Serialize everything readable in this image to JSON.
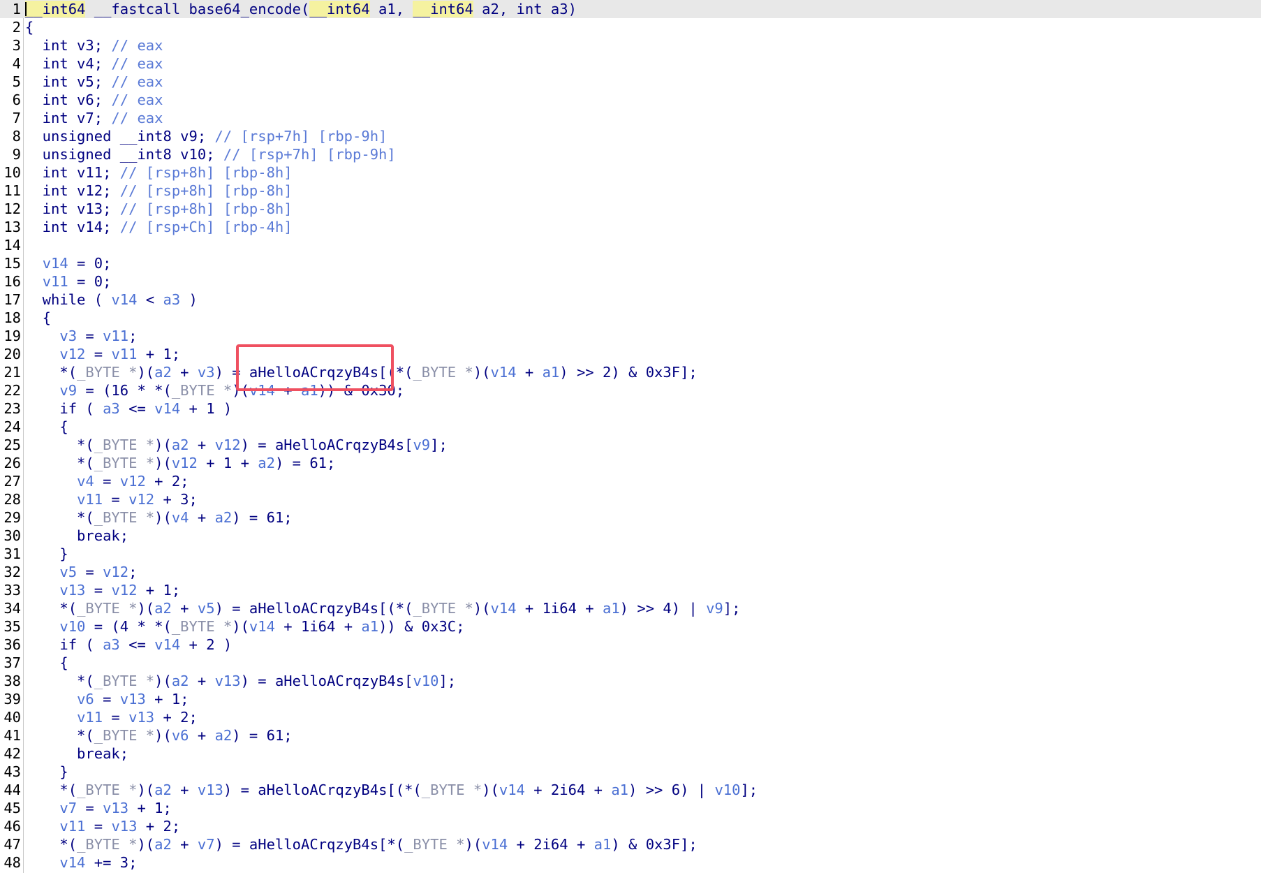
{
  "editor": {
    "type": "pseudocode-view",
    "current_line": 1,
    "lines": [
      {
        "n": "1",
        "tokens": [
          [
            "hl",
            "__int64"
          ],
          [
            "p",
            " __fastcall base64_encode("
          ],
          [
            "hl",
            "__int64"
          ],
          [
            "p",
            " a1, "
          ],
          [
            "hl",
            "__int64"
          ],
          [
            "p",
            " a2, int a3)"
          ]
        ]
      },
      {
        "n": "2",
        "tokens": [
          [
            "p",
            "{"
          ]
        ]
      },
      {
        "n": "3",
        "tokens": [
          [
            "p",
            "  int v3; "
          ],
          [
            "c",
            "// eax"
          ]
        ]
      },
      {
        "n": "4",
        "tokens": [
          [
            "p",
            "  int v4; "
          ],
          [
            "c",
            "// eax"
          ]
        ]
      },
      {
        "n": "5",
        "tokens": [
          [
            "p",
            "  int v5; "
          ],
          [
            "c",
            "// eax"
          ]
        ]
      },
      {
        "n": "6",
        "tokens": [
          [
            "p",
            "  int v6; "
          ],
          [
            "c",
            "// eax"
          ]
        ]
      },
      {
        "n": "7",
        "tokens": [
          [
            "p",
            "  int v7; "
          ],
          [
            "c",
            "// eax"
          ]
        ]
      },
      {
        "n": "8",
        "tokens": [
          [
            "p",
            "  unsigned __int8 v9; "
          ],
          [
            "c",
            "// [rsp+7h] [rbp-9h]"
          ]
        ]
      },
      {
        "n": "9",
        "tokens": [
          [
            "p",
            "  unsigned __int8 v10; "
          ],
          [
            "c",
            "// [rsp+7h] [rbp-9h]"
          ]
        ]
      },
      {
        "n": "10",
        "tokens": [
          [
            "p",
            "  int v11; "
          ],
          [
            "c",
            "// [rsp+8h] [rbp-8h]"
          ]
        ]
      },
      {
        "n": "11",
        "tokens": [
          [
            "p",
            "  int v12; "
          ],
          [
            "c",
            "// [rsp+8h] [rbp-8h]"
          ]
        ]
      },
      {
        "n": "12",
        "tokens": [
          [
            "p",
            "  int v13; "
          ],
          [
            "c",
            "// [rsp+8h] [rbp-8h]"
          ]
        ]
      },
      {
        "n": "13",
        "tokens": [
          [
            "p",
            "  int v14; "
          ],
          [
            "c",
            "// [rsp+Ch] [rbp-4h]"
          ]
        ]
      },
      {
        "n": "14",
        "tokens": [
          [
            "p",
            ""
          ]
        ]
      },
      {
        "n": "15",
        "tokens": [
          [
            "p",
            "  "
          ],
          [
            "v",
            "v14"
          ],
          [
            "p",
            " = 0;"
          ]
        ]
      },
      {
        "n": "16",
        "tokens": [
          [
            "p",
            "  "
          ],
          [
            "v",
            "v11"
          ],
          [
            "p",
            " = 0;"
          ]
        ]
      },
      {
        "n": "17",
        "tokens": [
          [
            "p",
            "  while ( "
          ],
          [
            "v",
            "v14"
          ],
          [
            "p",
            " < "
          ],
          [
            "v",
            "a3"
          ],
          [
            "p",
            " )"
          ]
        ]
      },
      {
        "n": "18",
        "tokens": [
          [
            "p",
            "  {"
          ]
        ]
      },
      {
        "n": "19",
        "tokens": [
          [
            "p",
            "    "
          ],
          [
            "v",
            "v3"
          ],
          [
            "p",
            " = "
          ],
          [
            "v",
            "v11"
          ],
          [
            "p",
            ";"
          ]
        ]
      },
      {
        "n": "20",
        "tokens": [
          [
            "p",
            "    "
          ],
          [
            "v",
            "v12"
          ],
          [
            "p",
            " = "
          ],
          [
            "v",
            "v11"
          ],
          [
            "p",
            " + 1;"
          ]
        ]
      },
      {
        "n": "21",
        "tokens": [
          [
            "p",
            "    *("
          ],
          [
            "g",
            "_BYTE *"
          ],
          [
            "p",
            ")("
          ],
          [
            "v",
            "a2"
          ],
          [
            "p",
            " + "
          ],
          [
            "v",
            "v3"
          ],
          [
            "p",
            ") = aHelloACrqzyB4s[(*("
          ],
          [
            "g",
            "_BYTE *"
          ],
          [
            "p",
            ")("
          ],
          [
            "v",
            "v14"
          ],
          [
            "p",
            " + "
          ],
          [
            "v",
            "a1"
          ],
          [
            "p",
            ") >> 2) & 0x3F];"
          ]
        ]
      },
      {
        "n": "22",
        "tokens": [
          [
            "p",
            "    "
          ],
          [
            "v",
            "v9"
          ],
          [
            "p",
            " = (16 * *("
          ],
          [
            "g",
            "_BYTE *"
          ],
          [
            "p",
            ")("
          ],
          [
            "v",
            "v14"
          ],
          [
            "p",
            " + "
          ],
          [
            "v",
            "a1"
          ],
          [
            "p",
            ")) & 0x30;"
          ]
        ]
      },
      {
        "n": "23",
        "tokens": [
          [
            "p",
            "    if ( "
          ],
          [
            "v",
            "a3"
          ],
          [
            "p",
            " <= "
          ],
          [
            "v",
            "v14"
          ],
          [
            "p",
            " + 1 )"
          ]
        ]
      },
      {
        "n": "24",
        "tokens": [
          [
            "p",
            "    {"
          ]
        ]
      },
      {
        "n": "25",
        "tokens": [
          [
            "p",
            "      *("
          ],
          [
            "g",
            "_BYTE *"
          ],
          [
            "p",
            ")("
          ],
          [
            "v",
            "a2"
          ],
          [
            "p",
            " + "
          ],
          [
            "v",
            "v12"
          ],
          [
            "p",
            ") = aHelloACrqzyB4s["
          ],
          [
            "v",
            "v9"
          ],
          [
            "p",
            "];"
          ]
        ]
      },
      {
        "n": "26",
        "tokens": [
          [
            "p",
            "      *("
          ],
          [
            "g",
            "_BYTE *"
          ],
          [
            "p",
            ")("
          ],
          [
            "v",
            "v12"
          ],
          [
            "p",
            " + 1 + "
          ],
          [
            "v",
            "a2"
          ],
          [
            "p",
            ") = 61;"
          ]
        ]
      },
      {
        "n": "27",
        "tokens": [
          [
            "p",
            "      "
          ],
          [
            "v",
            "v4"
          ],
          [
            "p",
            " = "
          ],
          [
            "v",
            "v12"
          ],
          [
            "p",
            " + 2;"
          ]
        ]
      },
      {
        "n": "28",
        "tokens": [
          [
            "p",
            "      "
          ],
          [
            "v",
            "v11"
          ],
          [
            "p",
            " = "
          ],
          [
            "v",
            "v12"
          ],
          [
            "p",
            " + 3;"
          ]
        ]
      },
      {
        "n": "29",
        "tokens": [
          [
            "p",
            "      *("
          ],
          [
            "g",
            "_BYTE *"
          ],
          [
            "p",
            ")("
          ],
          [
            "v",
            "v4"
          ],
          [
            "p",
            " + "
          ],
          [
            "v",
            "a2"
          ],
          [
            "p",
            ") = 61;"
          ]
        ]
      },
      {
        "n": "30",
        "tokens": [
          [
            "p",
            "      break;"
          ]
        ]
      },
      {
        "n": "31",
        "tokens": [
          [
            "p",
            "    }"
          ]
        ]
      },
      {
        "n": "32",
        "tokens": [
          [
            "p",
            "    "
          ],
          [
            "v",
            "v5"
          ],
          [
            "p",
            " = "
          ],
          [
            "v",
            "v12"
          ],
          [
            "p",
            ";"
          ]
        ]
      },
      {
        "n": "33",
        "tokens": [
          [
            "p",
            "    "
          ],
          [
            "v",
            "v13"
          ],
          [
            "p",
            " = "
          ],
          [
            "v",
            "v12"
          ],
          [
            "p",
            " + 1;"
          ]
        ]
      },
      {
        "n": "34",
        "tokens": [
          [
            "p",
            "    *("
          ],
          [
            "g",
            "_BYTE *"
          ],
          [
            "p",
            ")("
          ],
          [
            "v",
            "a2"
          ],
          [
            "p",
            " + "
          ],
          [
            "v",
            "v5"
          ],
          [
            "p",
            ") = aHelloACrqzyB4s[(*("
          ],
          [
            "g",
            "_BYTE *"
          ],
          [
            "p",
            ")("
          ],
          [
            "v",
            "v14"
          ],
          [
            "p",
            " + 1i64 + "
          ],
          [
            "v",
            "a1"
          ],
          [
            "p",
            ") >> 4) | "
          ],
          [
            "v",
            "v9"
          ],
          [
            "p",
            "];"
          ]
        ]
      },
      {
        "n": "35",
        "tokens": [
          [
            "p",
            "    "
          ],
          [
            "v",
            "v10"
          ],
          [
            "p",
            " = (4 * *("
          ],
          [
            "g",
            "_BYTE *"
          ],
          [
            "p",
            ")("
          ],
          [
            "v",
            "v14"
          ],
          [
            "p",
            " + 1i64 + "
          ],
          [
            "v",
            "a1"
          ],
          [
            "p",
            ")) & 0x3C;"
          ]
        ]
      },
      {
        "n": "36",
        "tokens": [
          [
            "p",
            "    if ( "
          ],
          [
            "v",
            "a3"
          ],
          [
            "p",
            " <= "
          ],
          [
            "v",
            "v14"
          ],
          [
            "p",
            " + 2 )"
          ]
        ]
      },
      {
        "n": "37",
        "tokens": [
          [
            "p",
            "    {"
          ]
        ]
      },
      {
        "n": "38",
        "tokens": [
          [
            "p",
            "      *("
          ],
          [
            "g",
            "_BYTE *"
          ],
          [
            "p",
            ")("
          ],
          [
            "v",
            "a2"
          ],
          [
            "p",
            " + "
          ],
          [
            "v",
            "v13"
          ],
          [
            "p",
            ") = aHelloACrqzyB4s["
          ],
          [
            "v",
            "v10"
          ],
          [
            "p",
            "];"
          ]
        ]
      },
      {
        "n": "39",
        "tokens": [
          [
            "p",
            "      "
          ],
          [
            "v",
            "v6"
          ],
          [
            "p",
            " = "
          ],
          [
            "v",
            "v13"
          ],
          [
            "p",
            " + 1;"
          ]
        ]
      },
      {
        "n": "40",
        "tokens": [
          [
            "p",
            "      "
          ],
          [
            "v",
            "v11"
          ],
          [
            "p",
            " = "
          ],
          [
            "v",
            "v13"
          ],
          [
            "p",
            " + 2;"
          ]
        ]
      },
      {
        "n": "41",
        "tokens": [
          [
            "p",
            "      *("
          ],
          [
            "g",
            "_BYTE *"
          ],
          [
            "p",
            ")("
          ],
          [
            "v",
            "v6"
          ],
          [
            "p",
            " + "
          ],
          [
            "v",
            "a2"
          ],
          [
            "p",
            ") = 61;"
          ]
        ]
      },
      {
        "n": "42",
        "tokens": [
          [
            "p",
            "      break;"
          ]
        ]
      },
      {
        "n": "43",
        "tokens": [
          [
            "p",
            "    }"
          ]
        ]
      },
      {
        "n": "44",
        "tokens": [
          [
            "p",
            "    *("
          ],
          [
            "g",
            "_BYTE *"
          ],
          [
            "p",
            ")("
          ],
          [
            "v",
            "a2"
          ],
          [
            "p",
            " + "
          ],
          [
            "v",
            "v13"
          ],
          [
            "p",
            ") = aHelloACrqzyB4s[(*("
          ],
          [
            "g",
            "_BYTE *"
          ],
          [
            "p",
            ")("
          ],
          [
            "v",
            "v14"
          ],
          [
            "p",
            " + 2i64 + "
          ],
          [
            "v",
            "a1"
          ],
          [
            "p",
            ") >> 6) | "
          ],
          [
            "v",
            "v10"
          ],
          [
            "p",
            "];"
          ]
        ]
      },
      {
        "n": "45",
        "tokens": [
          [
            "p",
            "    "
          ],
          [
            "v",
            "v7"
          ],
          [
            "p",
            " = "
          ],
          [
            "v",
            "v13"
          ],
          [
            "p",
            " + 1;"
          ]
        ]
      },
      {
        "n": "46",
        "tokens": [
          [
            "p",
            "    "
          ],
          [
            "v",
            "v11"
          ],
          [
            "p",
            " = "
          ],
          [
            "v",
            "v13"
          ],
          [
            "p",
            " + 2;"
          ]
        ]
      },
      {
        "n": "47",
        "tokens": [
          [
            "p",
            "    *("
          ],
          [
            "g",
            "_BYTE *"
          ],
          [
            "p",
            ")("
          ],
          [
            "v",
            "a2"
          ],
          [
            "p",
            " + "
          ],
          [
            "v",
            "v7"
          ],
          [
            "p",
            ") = aHelloACrqzyB4s[*("
          ],
          [
            "g",
            "_BYTE *"
          ],
          [
            "p",
            ")("
          ],
          [
            "v",
            "v14"
          ],
          [
            "p",
            " + 2i64 + "
          ],
          [
            "v",
            "a1"
          ],
          [
            "p",
            ") & 0x3F];"
          ]
        ]
      },
      {
        "n": "48",
        "tokens": [
          [
            "p",
            "    "
          ],
          [
            "v",
            "v14"
          ],
          [
            "p",
            " += 3;"
          ]
        ]
      }
    ]
  },
  "colors": {
    "keyword": "#000080",
    "variable": "#4a6fd3",
    "comment": "#5a7ad6",
    "type_cast": "#8a8fa8",
    "highlight_bg": "#f5f2a0",
    "annotation_box": "#ef5060",
    "current_line_bg": "#e8e8e8"
  }
}
